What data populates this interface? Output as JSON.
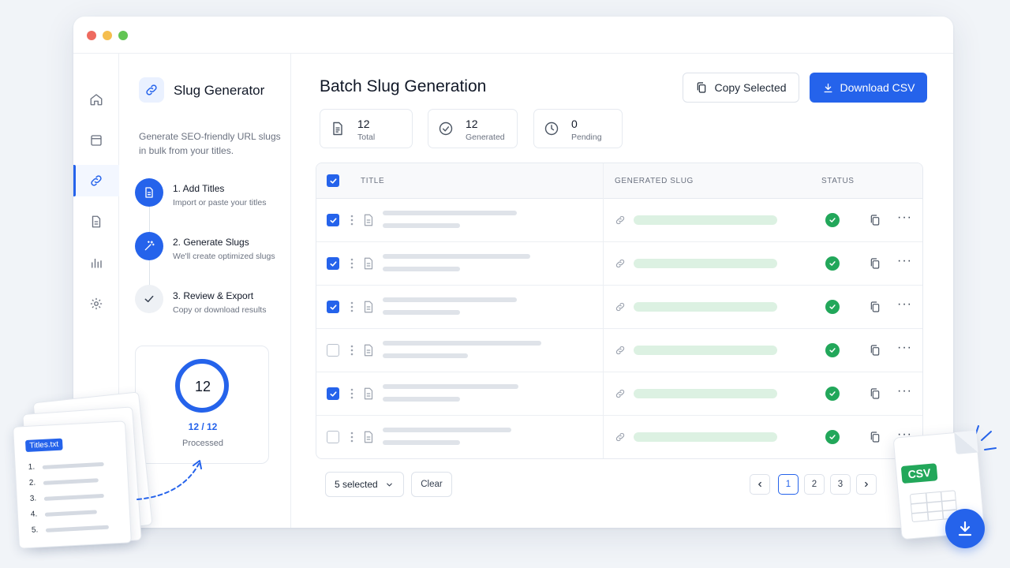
{
  "app": {
    "title": "Slug Generator",
    "description": "Generate SEO-friendly URL slugs in bulk from your titles."
  },
  "rail": [
    "home-icon",
    "window-icon",
    "link-icon",
    "document-icon",
    "chart-icon",
    "settings-icon"
  ],
  "steps": [
    {
      "title": "1. Add Titles",
      "subtitle": "Import or paste your titles",
      "state": "done"
    },
    {
      "title": "2. Generate Slugs",
      "subtitle": "We'll create optimized slugs",
      "state": "done"
    },
    {
      "title": "3. Review & Export",
      "subtitle": "Copy or download results",
      "state": "current"
    }
  ],
  "progress": {
    "count": "12",
    "ratio": "12 / 12",
    "label": "Processed",
    "fraction": 1.0
  },
  "main": {
    "title": "Batch Slug Generation",
    "copy_label": "Copy Selected",
    "download_label": "Download CSV"
  },
  "stats": [
    {
      "value": "12",
      "label": "Total"
    },
    {
      "value": "12",
      "label": "Generated"
    },
    {
      "value": "0",
      "label": "Pending"
    }
  ],
  "table": {
    "headers": {
      "title": "TITLE",
      "slug": "GENERATED SLUG",
      "status": "STATUS"
    },
    "rows": [
      {
        "checked": true,
        "status": "success"
      },
      {
        "checked": true,
        "status": "success"
      },
      {
        "checked": true,
        "status": "success"
      },
      {
        "checked": false,
        "status": "success"
      },
      {
        "checked": true,
        "status": "success"
      },
      {
        "checked": false,
        "status": "success"
      }
    ]
  },
  "footer": {
    "selected_label": "5 selected",
    "clear_label": "Clear",
    "pages": [
      "1",
      "2",
      "3"
    ],
    "current_page": "1"
  },
  "import_file": {
    "name": "Titles.txt",
    "items": [
      "1.",
      "2.",
      "3.",
      "4.",
      "5."
    ]
  },
  "export_file": {
    "tag": "CSV"
  },
  "colors": {
    "accent": "#2563eb",
    "success": "#22a75a",
    "slug_placeholder": "#dcf1e2"
  }
}
